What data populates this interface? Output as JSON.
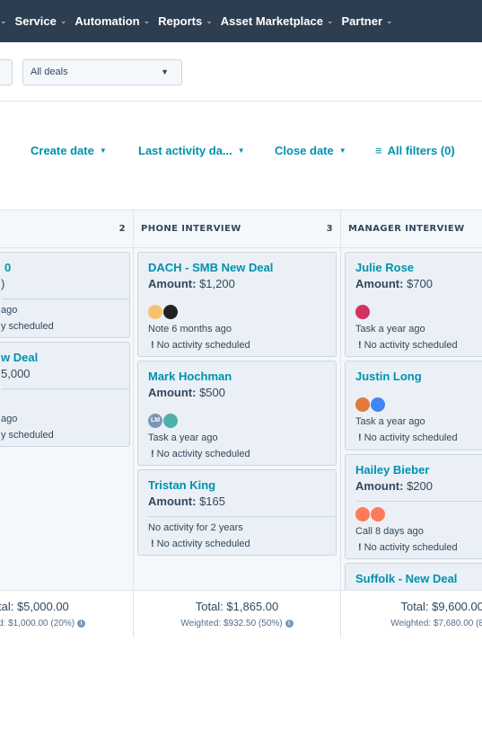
{
  "nav": {
    "items": [
      {
        "label": "Service"
      },
      {
        "label": "Automation"
      },
      {
        "label": "Reports"
      },
      {
        "label": "Asset Marketplace"
      },
      {
        "label": "Partner"
      }
    ]
  },
  "filters": {
    "pipeline_select": "All deals"
  },
  "sort": {
    "create_date": "Create date",
    "last_activity": "Last activity da...",
    "close_date": "Close date",
    "all_filters": "All filters (0)"
  },
  "columns": {
    "left": {
      "count": "2",
      "cards": [
        {
          "title": "0",
          "amount_value": ")",
          "activity": "ago",
          "no_activity": "y scheduled"
        },
        {
          "title": "w Deal",
          "amount_value": "5,000",
          "activity": "ago",
          "no_activity": "y scheduled"
        }
      ],
      "total": "tal: $5,000.00",
      "weighted": "d: $1,000.00 (20%)"
    },
    "phone": {
      "name": "PHONE INTERVIEW",
      "count": "3",
      "cards": [
        {
          "title": "DACH - SMB New Deal",
          "amount_label": "Amount:",
          "amount_value": "$1,200",
          "activity": "Note 6 months ago",
          "no_activity": "No activity scheduled"
        },
        {
          "title": "Mark Hochman",
          "amount_label": "Amount:",
          "amount_value": "$500",
          "avatar_initials": "LM",
          "activity": "Task a year ago",
          "no_activity": "No activity scheduled"
        },
        {
          "title": "Tristan King",
          "amount_label": "Amount:",
          "amount_value": "$165",
          "activity": "No activity for 2 years",
          "no_activity": "No activity scheduled"
        }
      ],
      "total": "Total: $1,865.00",
      "weighted": "Weighted: $932.50 (50%)"
    },
    "manager": {
      "name": "MANAGER INTERVIEW",
      "cards": [
        {
          "title": "Julie Rose",
          "amount_label": "Amount:",
          "amount_value": "$700",
          "activity": "Task a year ago",
          "no_activity": "No activity scheduled"
        },
        {
          "title": "Justin Long",
          "activity": "Task a year ago",
          "no_activity": "No activity scheduled"
        },
        {
          "title": "Hailey Bieber",
          "amount_label": "Amount:",
          "amount_value": "$200",
          "activity": "Call 8 days ago",
          "no_activity": "No activity scheduled"
        },
        {
          "title": "Suffolk - New Deal"
        }
      ],
      "total": "Total: $9,600.00",
      "weighted": "Weighted: $7,680.00 (8"
    }
  },
  "colors": {
    "nav_bg": "#2d3e50",
    "link": "#0091ae",
    "card_bg": "#eaf0f6",
    "text": "#33475b"
  }
}
